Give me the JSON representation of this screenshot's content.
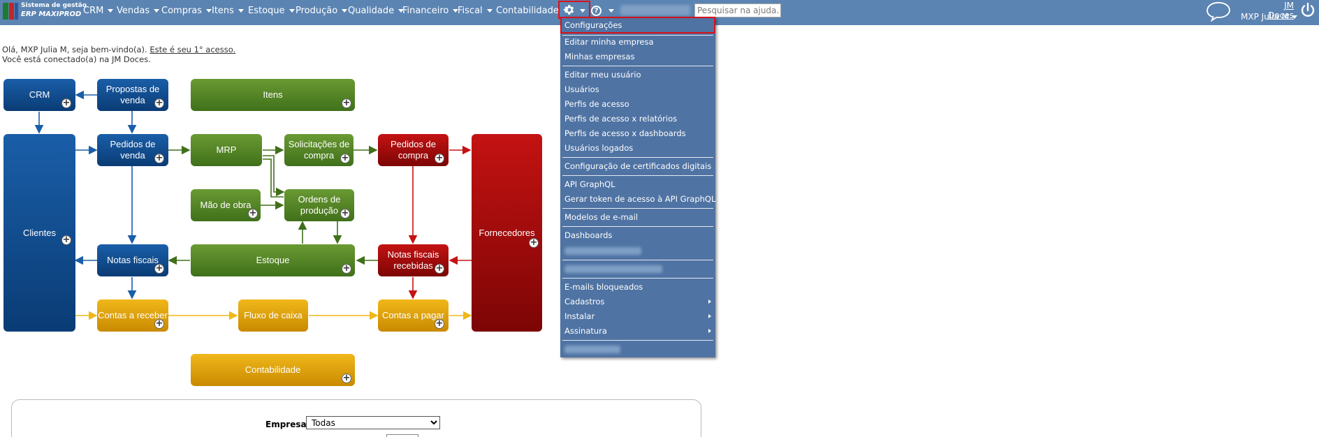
{
  "header": {
    "brand_line1": "Sistema de gestão",
    "brand_line2": "ERP MAXIPROD",
    "menu": [
      {
        "label": "CRM"
      },
      {
        "label": "Vendas"
      },
      {
        "label": "Compras"
      },
      {
        "label": "Itens"
      },
      {
        "label": "Estoque"
      },
      {
        "label": "Produção"
      },
      {
        "label": "Qualidade"
      },
      {
        "label": "Financeiro"
      },
      {
        "label": "Fiscal"
      },
      {
        "label": "Contabilidade"
      }
    ],
    "search_placeholder": "Pesquisar na ajuda...",
    "help_glyph": "?",
    "company_link": "JM Doces",
    "user_name": "MXP Julia M",
    "icons": [
      "gear-icon",
      "help-icon",
      "chat-icon",
      "power-icon"
    ],
    "colors": {
      "bar": "#5b84b2",
      "highlight": "#d8111b"
    }
  },
  "welcome": {
    "line1_prefix": "Olá, MXP Julia M, seja bem-vindo(a). ",
    "line1_link": "Este é seu 1° acesso.",
    "line2": "Você está conectado(a) na JM Doces."
  },
  "flow": {
    "crm": "CRM",
    "propostas": "Propostas de venda",
    "itens": "Itens",
    "clientes": "Clientes",
    "pedidos_venda": "Pedidos de venda",
    "mrp": "MRP",
    "solicitacoes": "Solicitações de compra",
    "pedidos_compra": "Pedidos de compra",
    "fornecedores": "Fornecedores",
    "mao_obra": "Mão de obra",
    "ordens": "Ordens de produção",
    "notas_fiscais": "Notas fiscais",
    "estoque": "Estoque",
    "notas_recebidas": "Notas fiscais recebidas",
    "contas_receber": "Contas a receber",
    "fluxo_caixa": "Fluxo de caixa",
    "contas_pagar": "Contas a pagar",
    "contabilidade": "Contabilidade",
    "plus": "+"
  },
  "filter": {
    "empresa_label": "Empresa",
    "empresa_value": "Todas"
  },
  "settings_menu": {
    "items": [
      "Configurações",
      "Editar minha empresa",
      "Minhas empresas",
      "Editar meu usuário",
      "Usuários",
      "Perfis de acesso",
      "Perfis de acesso x relatórios",
      "Perfis de acesso x dashboards",
      "Usuários logados",
      "Configuração de certificados digitais",
      "API GraphQL",
      "Gerar token de acesso à API GraphQL",
      "Modelos de e-mail",
      "Dashboards",
      "E-mails bloqueados",
      "Cadastros",
      "Instalar",
      "Assinatura"
    ]
  }
}
